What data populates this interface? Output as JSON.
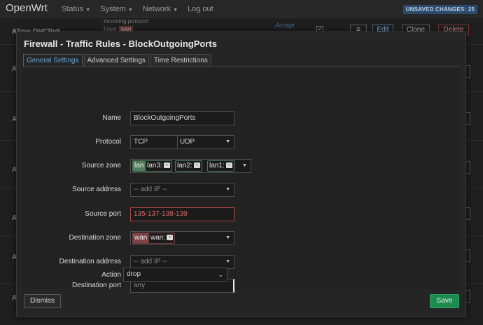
{
  "brand": "OpenWrt",
  "menu": [
    "Status",
    "System",
    "Network",
    "Log out"
  ],
  "unsaved_badge": "UNSAVED CHANGES: 25",
  "background": {
    "row_name": "Allow-DHCPv6",
    "row_incoming": "Incoming",
    "row_protocol": "protocol",
    "row_from": "From",
    "row_from_zone": "wan",
    "row_action": "Accept",
    "row_buttons": [
      "≡",
      "Edit",
      "Clone",
      "Delete"
    ],
    "row_letters": [
      "A",
      "A",
      "A",
      "A",
      "A",
      "A",
      "A",
      "A",
      "A"
    ]
  },
  "modal": {
    "title": "Firewall - Traffic Rules - BlockOutgoingPorts",
    "tabs": [
      "General Settings",
      "Advanced Settings",
      "Time Restrictions"
    ],
    "labels": {
      "name": "Name",
      "protocol": "Protocol",
      "source_zone": "Source zone",
      "source_address": "Source address",
      "source_port": "Source port",
      "destination_zone": "Destination zone",
      "destination_address": "Destination address",
      "destination_port": "Destination port",
      "action": "Action"
    },
    "values": {
      "name": "BlockOutgoingPorts",
      "protocol": [
        "TCP",
        "UDP"
      ],
      "source_zone_tag": "lan",
      "source_zone_ifaces": [
        "lan3:",
        "lan2:",
        "lan1:"
      ],
      "source_address_placeholder": "-- add IP --",
      "source_port": "135-137-138-139",
      "destination_zone_tag": "wan",
      "destination_zone_iface": "wan:",
      "destination_address_placeholder": "-- add IP --",
      "destination_port_placeholder": "any",
      "action": "drop"
    },
    "dismiss": "Dismiss",
    "save": "Save"
  },
  "colors": {
    "accent_blue": "#6aa6d9",
    "save_green": "#1d8a4e",
    "error_red": "#d46a6a",
    "lan_green": "#4f7d5b",
    "wan_red": "#7a4242"
  }
}
